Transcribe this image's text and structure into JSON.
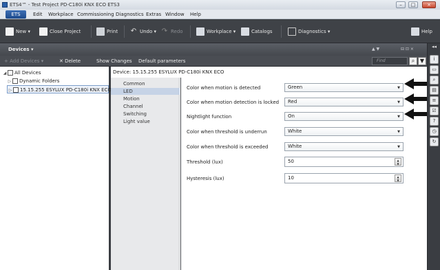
{
  "window": {
    "title": "ETS4™ - Test Project PD-C180i KNX ECO ETS3",
    "minimize": "–",
    "maximize": "□",
    "close": "×"
  },
  "menu": {
    "ets_label": "ETS",
    "items": [
      "Edit",
      "Workplace",
      "Commissioning",
      "Diagnostics",
      "Extras",
      "Window",
      "Help"
    ]
  },
  "toolbar": {
    "new_label": "New",
    "close_project_label": "Close Project",
    "print_label": "Print",
    "undo_label": "Undo",
    "redo_label": "Redo",
    "workplace_label": "Workplace",
    "catalogs_label": "Catalogs",
    "diagnostics_label": "Diagnostics",
    "help_label": "Help"
  },
  "panel": {
    "title": "Devices",
    "title_dropdown": "▾",
    "controls": "▲ ▼",
    "window_controls": "⊟ ⊡ ×"
  },
  "subtoolbar": {
    "add_devices_label": "Add Devices",
    "delete_label": "Delete",
    "show_changes_label": "Show Changes",
    "default_parameters_label": "Default parameters",
    "find_placeholder": "Find"
  },
  "tree": {
    "items": [
      {
        "label": "All Devices",
        "expander": "◢"
      },
      {
        "label": "Dynamic Folders",
        "expander": "▷"
      },
      {
        "label": "15.15.255  ESYLUX PD-C180i KNX ECO",
        "expander": "▷"
      }
    ]
  },
  "device": {
    "title": "Device: 15.15.255  ESYLUX PD-C180i KNX ECO",
    "categories": [
      "Common",
      "LED",
      "Motion",
      "Channel",
      "Switching",
      "Light value"
    ],
    "active_category": "LED"
  },
  "params": [
    {
      "label": "Color when motion is detected",
      "kind": "select",
      "value": "Green"
    },
    {
      "label": "Color when motion detection is locked",
      "kind": "select",
      "value": "Red"
    },
    {
      "label": "Nightlight function",
      "kind": "select",
      "value": "On"
    },
    {
      "label": "Color when threshold is underrun",
      "kind": "select",
      "value": "White"
    },
    {
      "label": "Color when threshold is exceeded",
      "kind": "select",
      "value": "White"
    },
    {
      "label": "Threshold (lux)",
      "kind": "number",
      "value": "50"
    },
    {
      "label": "Hysteresis (lux)",
      "kind": "number",
      "value": "10"
    }
  ],
  "colors": {
    "accent": "#2a5fa8",
    "dark_chrome": "#3f4247",
    "selected_category": "#c6d3e6"
  }
}
